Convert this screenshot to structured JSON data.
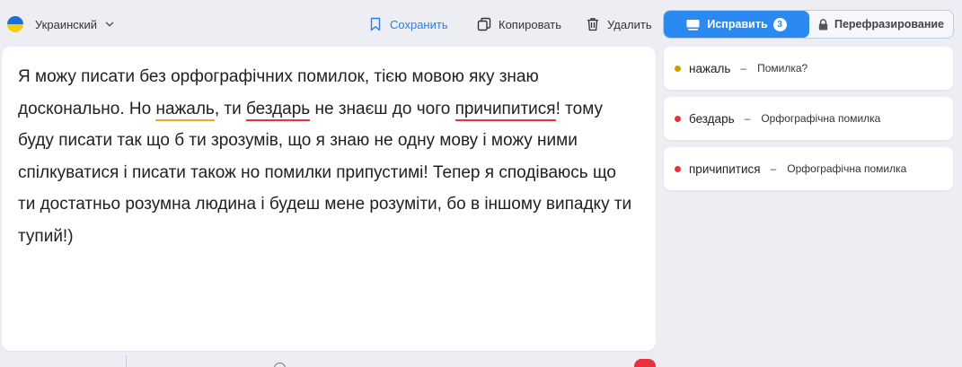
{
  "toolbar": {
    "language": "Украинский",
    "save_label": "Сохранить",
    "copy_label": "Копировать",
    "delete_label": "Удалить"
  },
  "modes": {
    "fix_label": "Исправить",
    "fix_count": "3",
    "paraphrase_label": "Перефразирование"
  },
  "editor": {
    "segments": [
      "Я можу писати без орфографічних помилок, тією мовою яку знаю досконально. Но ",
      "нажаль",
      ", ти ",
      "бездарь",
      " не знаєш до чого ",
      "причипитися",
      "! тому буду писати так що б ти зрозумів, що я знаю не одну мову і можу ними спілкуватися і писати також но помилки припустимі! Тепер я сподіваюсь що ти достатньо розумна людина і будеш мене розуміти, бо в іншому випадку ти тупий!)"
    ]
  },
  "suggestions": [
    {
      "word": "нажаль",
      "type": "Помилка?",
      "color": "#c9a000"
    },
    {
      "word": "бездарь",
      "type": "Орфографічна помилка",
      "color": "#e8303f"
    },
    {
      "word": "причипитися",
      "type": "Орфографічна помилка",
      "color": "#e8303f"
    }
  ],
  "colors": {
    "accent": "#2a8af2",
    "error_red": "#e8303f",
    "warning_orange": "#f0a623"
  },
  "icons": {
    "flag": "ukraine-flag-icon",
    "save": "bookmark-icon",
    "copy": "copy-icon",
    "delete": "trash-icon",
    "fix": "keyboard-icon",
    "paraphrase": "lock-icon"
  }
}
